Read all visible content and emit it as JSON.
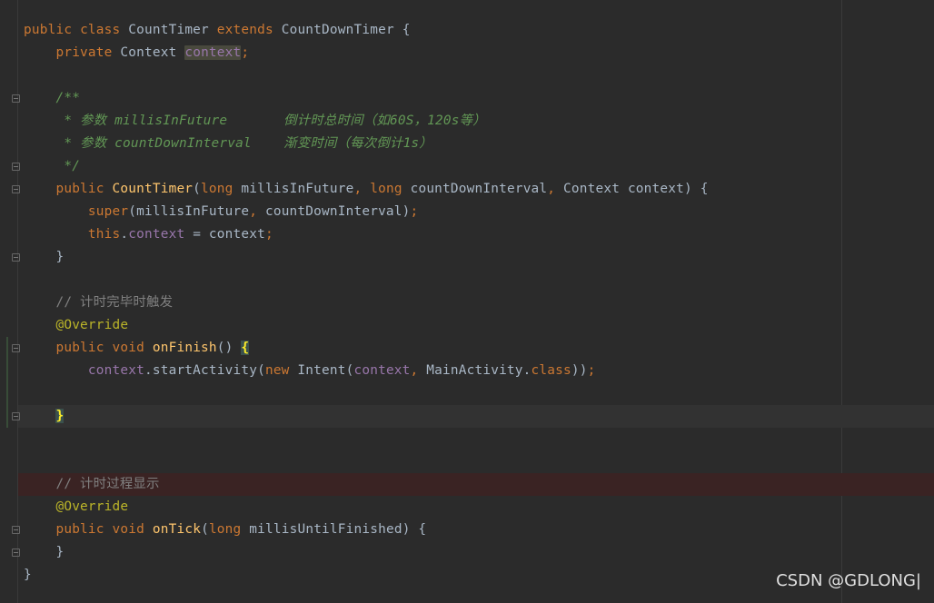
{
  "colors": {
    "background": "#2b2b2b",
    "keyword": "#cc7832",
    "method": "#ffc66d",
    "field": "#9876aa",
    "doc_comment": "#629755",
    "line_comment": "#808080",
    "annotation": "#bbb529",
    "plain": "#a9b7c6"
  },
  "code": {
    "l1": {
      "kw_public": "public",
      "kw_class": "class",
      "class_name": "CountTimer",
      "kw_extends": "extends",
      "super_class": "CountDownTimer",
      "brace": "{"
    },
    "l2": {
      "kw_private": "private",
      "type": "Context",
      "field": "context",
      "semi": ";"
    },
    "l4": {
      "text": "/**"
    },
    "l5": {
      "text": " * 参数 millisInFuture       倒计时总时间（如60S，120s等）"
    },
    "l6": {
      "text": " * 参数 countDownInterval    渐变时间（每次倒计1s）"
    },
    "l7": {
      "text": " */"
    },
    "l8": {
      "kw_public": "public",
      "ctor": "CountTimer",
      "open": "(",
      "kw_long1": "long",
      "p1": "millisInFuture",
      "comma1": ",",
      "kw_long2": "long",
      "p2": "countDownInterval",
      "comma2": ",",
      "p3": "Context context) {"
    },
    "l9": {
      "kw_super": "super",
      "args1": "(millisInFuture",
      "comma": ",",
      "args2": "countDownInterval)",
      "semi": ";"
    },
    "l10": {
      "kw_this": "this",
      "dot": ".",
      "field": "context",
      "rest": " = context",
      "semi": ";"
    },
    "l11": {
      "text": "}"
    },
    "l13": {
      "text": "// 计时完毕时触发"
    },
    "l14": {
      "text": "@Override"
    },
    "l15": {
      "kw_public": "public",
      "kw_void": "void",
      "method": "onFinish",
      "parens": "() ",
      "brace": "{"
    },
    "l16": {
      "field": "context",
      "call": ".startActivity(",
      "kw_new": "new",
      "ctor": "Intent(",
      "arg_field": "context",
      "comma": ",",
      "arg2": "MainActivity.",
      "kw_class": "class",
      "close": "))",
      "semi": ";"
    },
    "l18": {
      "brace": "}"
    },
    "l21": {
      "text": "// 计时过程显示"
    },
    "l22": {
      "text": "@Override"
    },
    "l23": {
      "kw_public": "public",
      "kw_void": "void",
      "method": "onTick",
      "open": "(",
      "kw_long": "long",
      "rest": "millisUntilFinished) {"
    },
    "l24": {
      "text": "}"
    },
    "l25": {
      "text": "}"
    }
  },
  "watermark": "CSDN @GDLONG|"
}
